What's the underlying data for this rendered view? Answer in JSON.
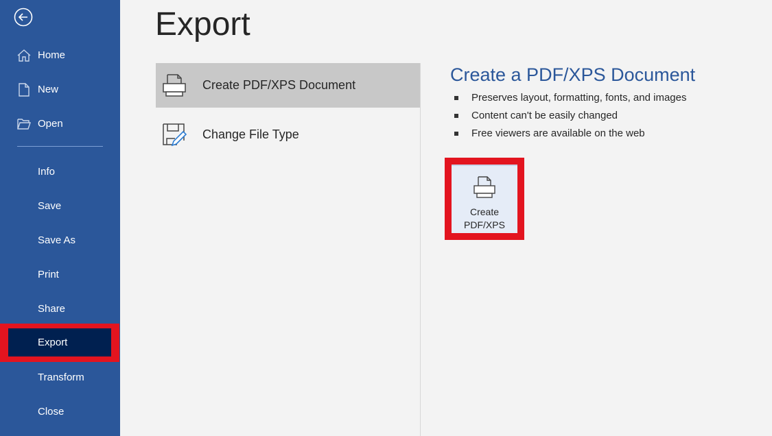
{
  "sidebar": {
    "back_icon": "back-arrow-circle-icon",
    "top_items": [
      {
        "label": "Home",
        "icon": "home-icon"
      },
      {
        "label": "New",
        "icon": "new-document-icon"
      },
      {
        "label": "Open",
        "icon": "open-folder-icon"
      }
    ],
    "items": [
      {
        "label": "Info"
      },
      {
        "label": "Save"
      },
      {
        "label": "Save As"
      },
      {
        "label": "Print"
      },
      {
        "label": "Share"
      },
      {
        "label": "Export",
        "selected": true
      },
      {
        "label": "Transform"
      },
      {
        "label": "Close"
      }
    ]
  },
  "main": {
    "title": "Export",
    "options": [
      {
        "label": "Create PDF/XPS Document",
        "icon": "pdf-printer-icon",
        "selected": true
      },
      {
        "label": "Change File Type",
        "icon": "change-file-type-icon"
      }
    ],
    "detail": {
      "title": "Create a PDF/XPS Document",
      "bullets": [
        "Preserves layout, formatting, fonts, and images",
        "Content can't be easily changed",
        "Free viewers are available on the web"
      ],
      "button_line1": "Create",
      "button_line2": "PDF/XPS"
    }
  },
  "colors": {
    "sidebar": "#2b579a",
    "selected_nav": "#002050",
    "highlight": "#e3141f",
    "accent_text": "#2b579a"
  }
}
